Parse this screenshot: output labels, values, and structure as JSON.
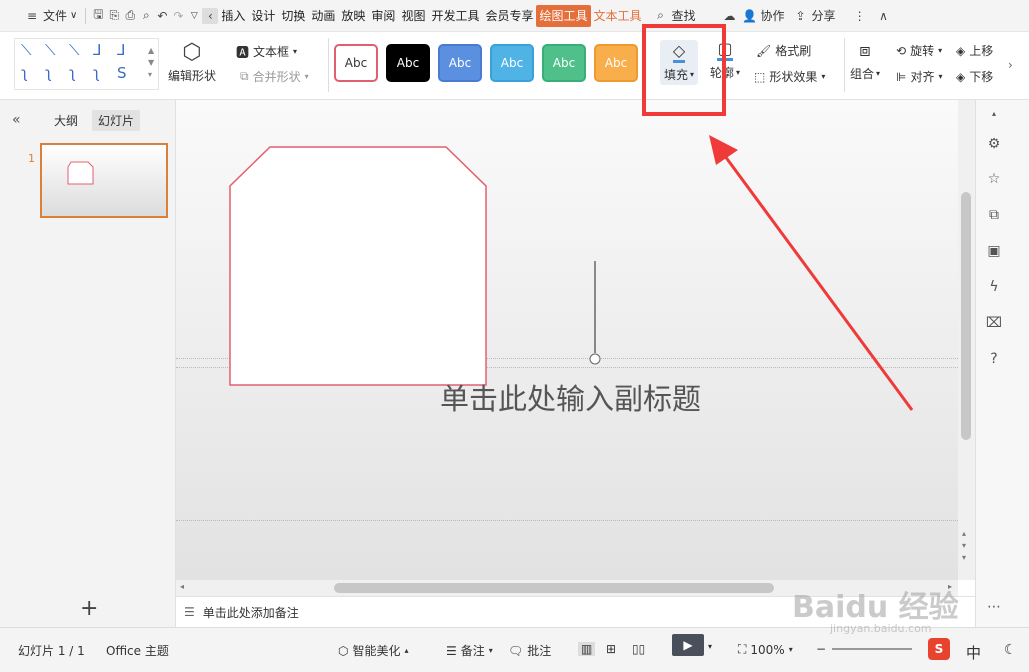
{
  "topbar": {
    "file_menu": "文件",
    "tabs": [
      "插入",
      "设计",
      "切换",
      "动画",
      "放映",
      "审阅",
      "视图",
      "开发工具",
      "会员专享",
      "绘图工具",
      "文本工具"
    ],
    "search": "查找",
    "collab": "协作",
    "share": "分享"
  },
  "ribbon": {
    "edit_shape": "编辑形状",
    "text_box": "文本框",
    "merge_shape": "合并形状",
    "style_samples": [
      {
        "label": "Abc",
        "bg": "#ffffff",
        "color": "#333333",
        "border": "#e06070"
      },
      {
        "label": "Abc",
        "bg": "#000000",
        "color": "#ffffff",
        "border": "#000000"
      },
      {
        "label": "Abc",
        "bg": "#5b8fe0",
        "color": "#ffffff",
        "border": "#4a7bd0"
      },
      {
        "label": "Abc",
        "bg": "#4fb3e6",
        "color": "#ffffff",
        "border": "#3aa0d8"
      },
      {
        "label": "Abc",
        "bg": "#4fc08a",
        "color": "#ffffff",
        "border": "#3aae78"
      },
      {
        "label": "Abc",
        "bg": "#f8ae4a",
        "color": "#ffffff",
        "border": "#ee9a30"
      }
    ],
    "fill": "填充",
    "outline": "轮廓",
    "format_painter": "格式刷",
    "shape_effects": "形状效果",
    "group": "组合",
    "rotate": "旋转",
    "align": "对齐",
    "bring_forward": "上移",
    "send_backward": "下移"
  },
  "left_panel": {
    "outline_tab": "大纲",
    "slides_tab": "幻灯片",
    "slide_number": "1"
  },
  "canvas": {
    "subtitle_placeholder": "单击此处输入副标题"
  },
  "notes": {
    "placeholder": "单击此处添加备注"
  },
  "status": {
    "slide_info": "幻灯片 1 / 1",
    "theme": "Office 主题",
    "smart_beautify": "智能美化",
    "notes": "备注",
    "comments": "批注",
    "zoom": "100%"
  },
  "taskbar": {
    "ime": "中"
  },
  "watermark": {
    "text": "Baidu 经验",
    "sub": "jingyan.baidu.com"
  },
  "colors": {
    "accent": "#e46f3a",
    "highlight": "#f03a3a",
    "shape_outline": "#e06070"
  }
}
